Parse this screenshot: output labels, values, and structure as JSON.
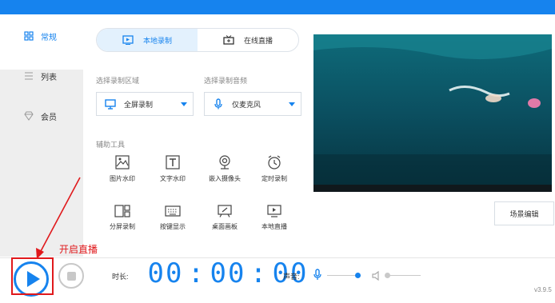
{
  "sidebar": {
    "items": [
      {
        "label": "常规",
        "icon": "grid-icon",
        "active": true
      },
      {
        "label": "列表",
        "icon": "list-icon",
        "active": false
      },
      {
        "label": "会员",
        "icon": "diamond-icon",
        "active": false
      }
    ]
  },
  "tabs": [
    {
      "label": "本地录制",
      "icon": "record-icon",
      "active": true
    },
    {
      "label": "在线直播",
      "icon": "tv-icon",
      "active": false
    }
  ],
  "area": {
    "label": "选择录制区域",
    "value": "全屏录制",
    "icon": "monitor-icon"
  },
  "audio": {
    "label": "选择录制音频",
    "value": "仅麦克风",
    "icon": "microphone-icon"
  },
  "tools": {
    "label": "辅助工具",
    "items": [
      {
        "label": "图片水印",
        "icon": "image-icon"
      },
      {
        "label": "文字水印",
        "icon": "text-icon"
      },
      {
        "label": "嵌入摄像头",
        "icon": "webcam-icon"
      },
      {
        "label": "定时录制",
        "icon": "alarm-clock-icon"
      },
      {
        "label": "分屏录制",
        "icon": "split-screen-icon"
      },
      {
        "label": "按键显示",
        "icon": "keyboard-icon"
      },
      {
        "label": "桌面画板",
        "icon": "drawing-board-icon"
      },
      {
        "label": "本地直播",
        "icon": "local-live-icon"
      }
    ]
  },
  "scene_button": "场景编辑",
  "annotation": "开启直播",
  "timer": {
    "label": "时长:",
    "hours": "00",
    "minutes": "00",
    "seconds": "00"
  },
  "volume": {
    "label": "声音:",
    "mic_level": 0.9,
    "speaker_level": 0.0
  },
  "version": "v3.9.5",
  "colors": {
    "accent": "#1683ee",
    "annotation": "#e0191c"
  }
}
